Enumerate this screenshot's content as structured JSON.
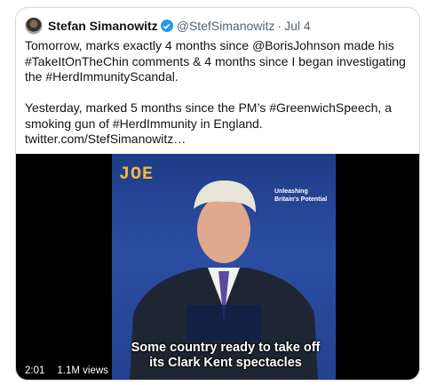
{
  "tweet": {
    "author_name": "Stefan Simanowitz",
    "verified_icon": "verified-badge-icon",
    "handle": "@StefSimanowitz",
    "separator": "·",
    "date": "Jul 4",
    "paragraph1": "Tomorrow, marks exactly 4 months since @BorisJohnson made his #TakeItOnTheChin comments & 4 months since I began investigating the #HerdImmunityScandal.",
    "paragraph2": "Yesterday, marked 5 months since the PM’s #GreenwichSpeech, a smoking gun of #HerdImmunity in England. twitter.com/StefSimanowitz…"
  },
  "video": {
    "logo": "JOE",
    "sign_text": "Unleashing Britain's Potential",
    "subtitle": "Some country ready to take off its Clark Kent spectacles",
    "duration": "2:01",
    "views": "1.1M views"
  },
  "colors": {
    "accent": "#1d9bf0",
    "text": "#0f1419",
    "secondary_text": "#536471",
    "border": "#cfd9de",
    "video_bg": "#000000",
    "logo": "#f4b63b"
  }
}
